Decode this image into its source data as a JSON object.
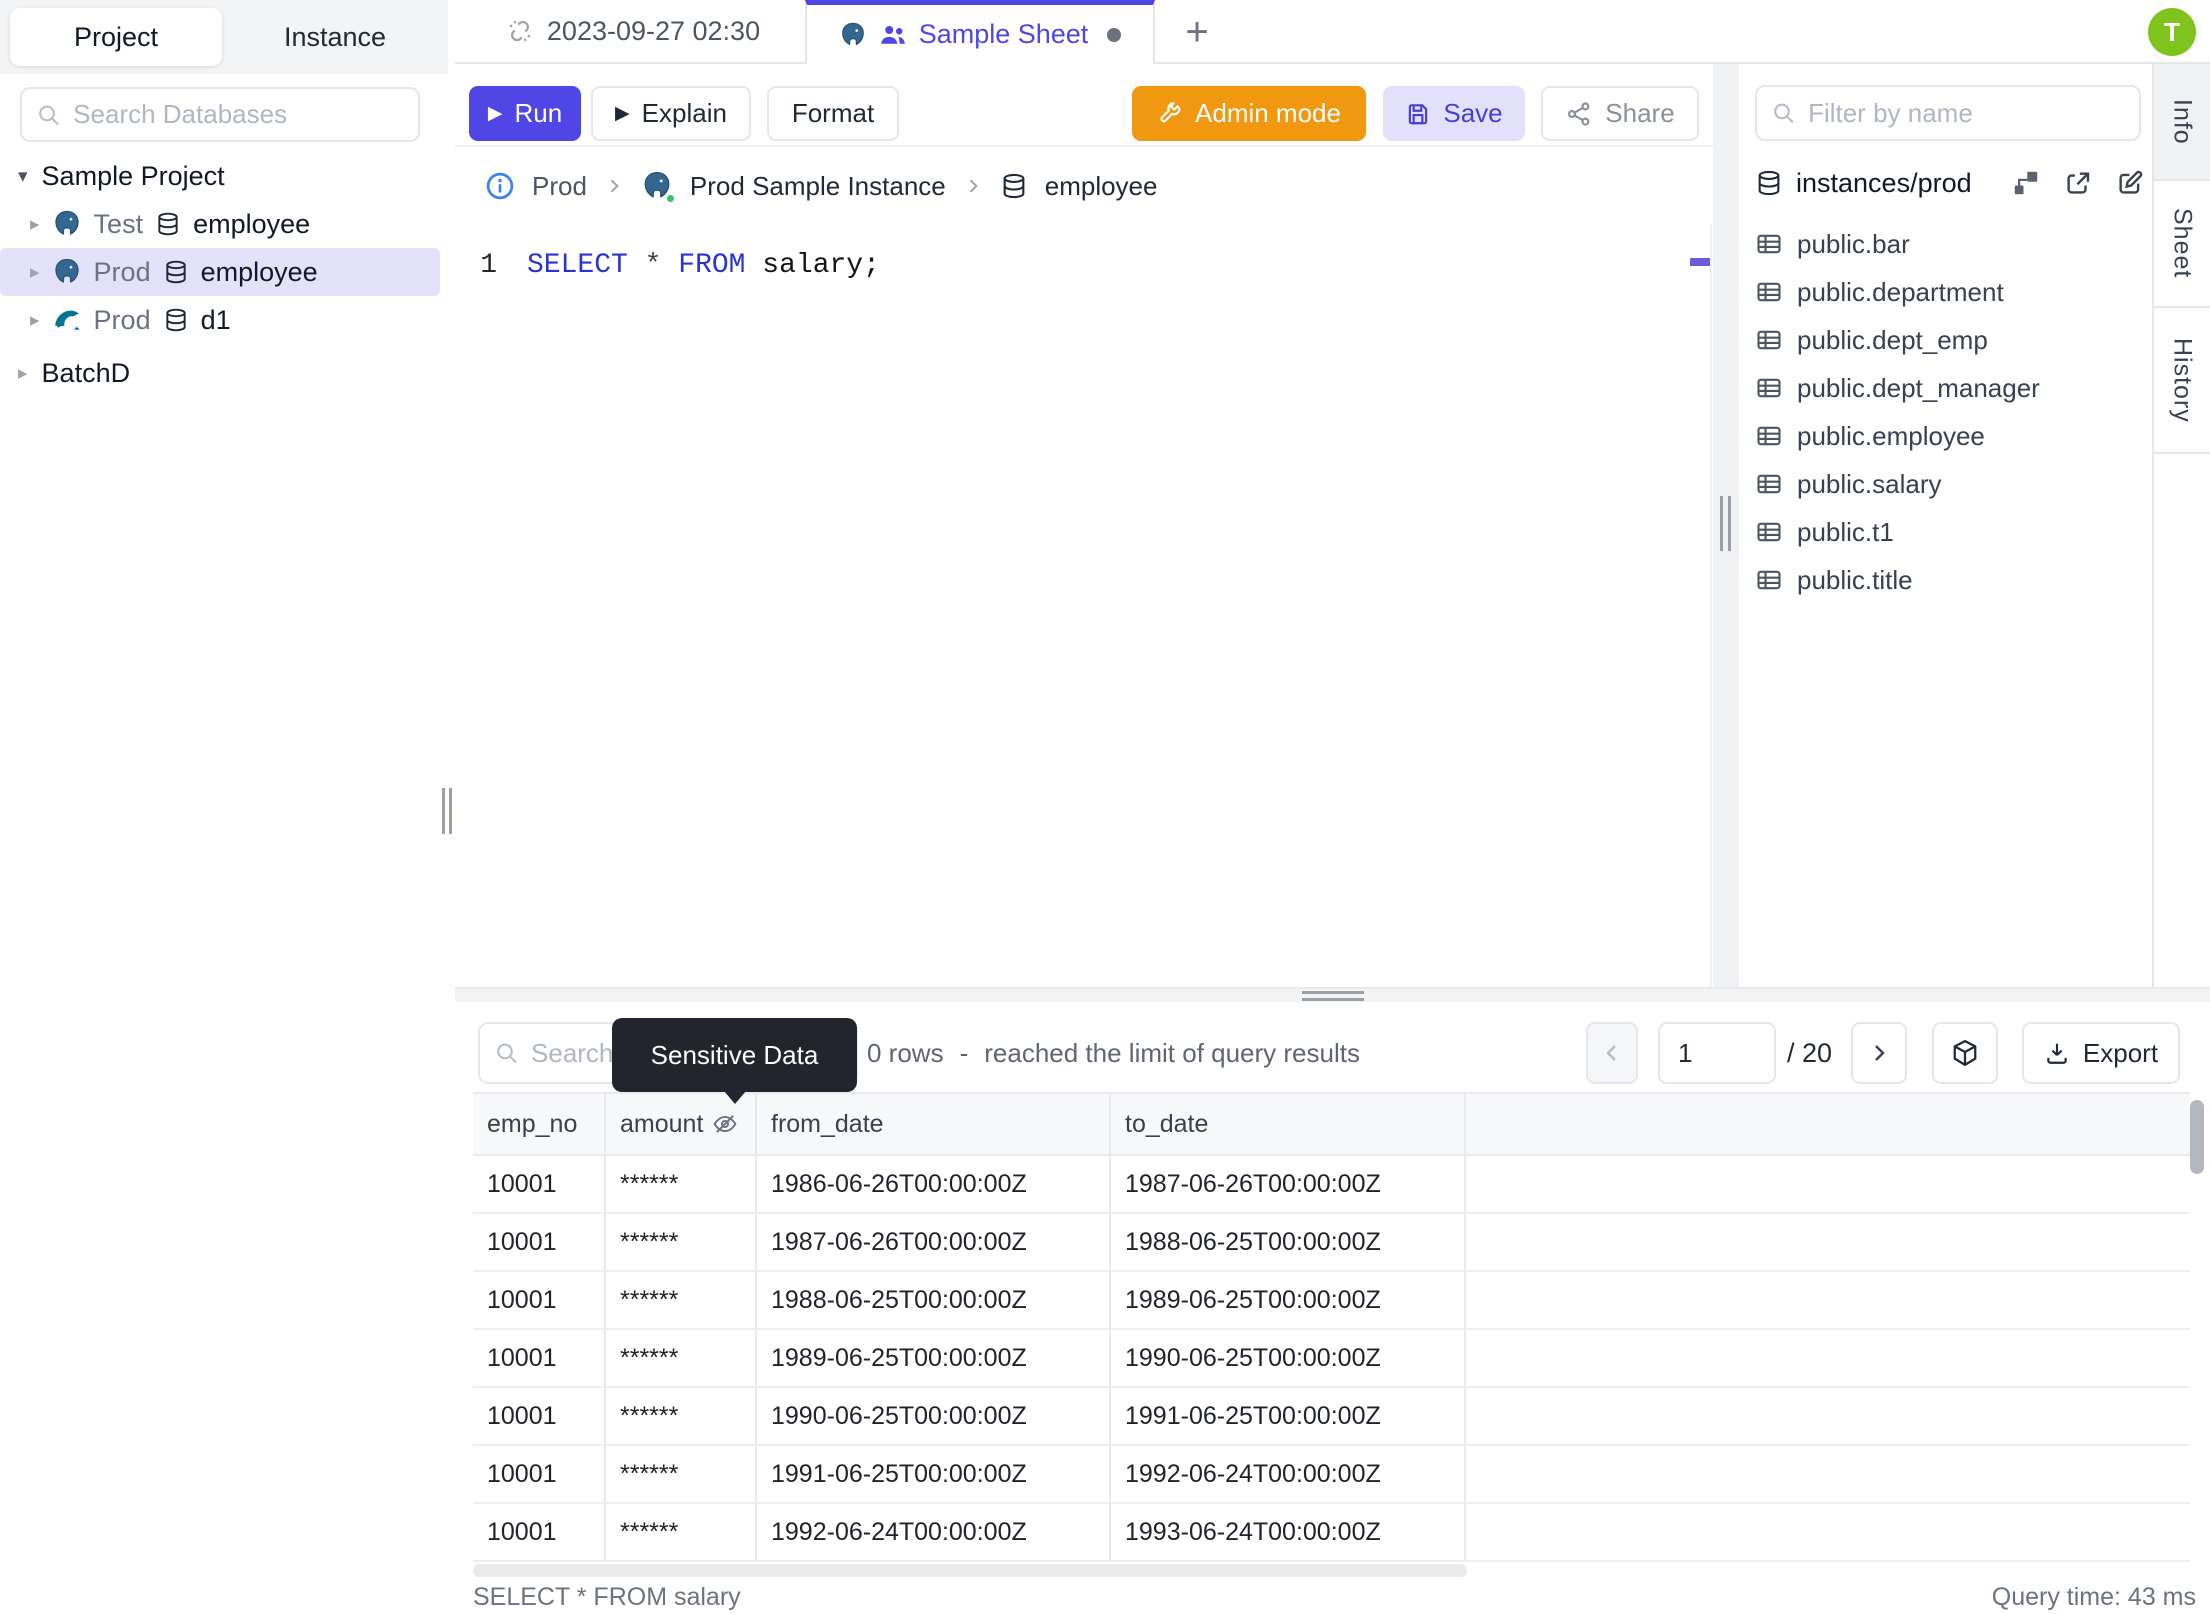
{
  "colors": {
    "accent": "#4f46e5",
    "admin_orange": "#f0980f",
    "save_bg": "#e2e0fb",
    "selected_row_bg": "#e4e1fa",
    "avatar_green": "#7fc41e",
    "tooltip_bg": "#22252d",
    "postgres_blue": "#336791",
    "mysql_teal": "#00758f"
  },
  "sidebar": {
    "tabs": {
      "project": "Project",
      "instance": "Instance"
    },
    "search_placeholder": "Search Databases",
    "project_label": "Sample Project",
    "tree": [
      {
        "engine": "postgres",
        "env": "Test",
        "db": "employee",
        "selected": false
      },
      {
        "engine": "postgres",
        "env": "Prod",
        "db": "employee",
        "selected": true
      },
      {
        "engine": "mysql",
        "env": "Prod",
        "db": "d1",
        "selected": false
      }
    ],
    "batch_label": "BatchD"
  },
  "tabbar": {
    "time_tab": "2023-09-27 02:30",
    "active_tab": "Sample Sheet",
    "add": "+"
  },
  "avatar_initial": "T",
  "toolbar": {
    "run": "Run",
    "explain": "Explain",
    "format": "Format",
    "admin": "Admin mode",
    "save": "Save",
    "share": "Share"
  },
  "breadcrumb": {
    "env": "Prod",
    "instance": "Prod Sample Instance",
    "database": "employee"
  },
  "editor": {
    "line_number": "1",
    "tokens": [
      {
        "text": "SELECT",
        "type": "kw"
      },
      {
        "text": " ",
        "type": "ws"
      },
      {
        "text": "*",
        "type": "op"
      },
      {
        "text": " ",
        "type": "ws"
      },
      {
        "text": "FROM",
        "type": "kw"
      },
      {
        "text": " ",
        "type": "ws"
      },
      {
        "text": "salary;",
        "type": "id"
      }
    ]
  },
  "schema_panel": {
    "filter_placeholder": "Filter by name",
    "source": "instances/prod",
    "tables": [
      "public.bar",
      "public.department",
      "public.dept_emp",
      "public.dept_manager",
      "public.employee",
      "public.salary",
      "public.t1",
      "public.title"
    ]
  },
  "side_tabs": [
    "Info",
    "Sheet",
    "History"
  ],
  "results": {
    "search_placeholder": "Search",
    "tooltip": "Sensitive Data",
    "rows_text": "0 rows",
    "dash": "-",
    "limit_text": "reached the limit of query results",
    "page": "1",
    "page_total": "/ 20",
    "export_label": "Export",
    "columns": [
      {
        "label": "emp_no",
        "masked": false
      },
      {
        "label": "amount",
        "masked": true
      },
      {
        "label": "from_date",
        "masked": false
      },
      {
        "label": "to_date",
        "masked": false
      }
    ],
    "rows": [
      [
        "10001",
        "******",
        "1986-06-26T00:00:00Z",
        "1987-06-26T00:00:00Z"
      ],
      [
        "10001",
        "******",
        "1987-06-26T00:00:00Z",
        "1988-06-25T00:00:00Z"
      ],
      [
        "10001",
        "******",
        "1988-06-25T00:00:00Z",
        "1989-06-25T00:00:00Z"
      ],
      [
        "10001",
        "******",
        "1989-06-25T00:00:00Z",
        "1990-06-25T00:00:00Z"
      ],
      [
        "10001",
        "******",
        "1990-06-25T00:00:00Z",
        "1991-06-25T00:00:00Z"
      ],
      [
        "10001",
        "******",
        "1991-06-25T00:00:00Z",
        "1992-06-24T00:00:00Z"
      ],
      [
        "10001",
        "******",
        "1992-06-24T00:00:00Z",
        "1993-06-24T00:00:00Z"
      ]
    ],
    "status_left": "SELECT * FROM salary",
    "status_right": "Query time: 43 ms"
  }
}
